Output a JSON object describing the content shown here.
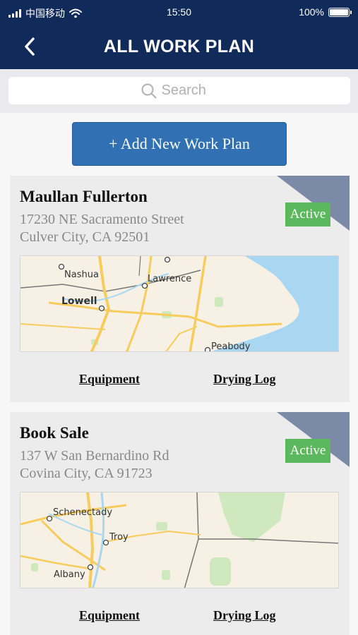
{
  "status_bar": {
    "carrier": "中国移动",
    "time": "15:50",
    "battery": "100%",
    "battery_level": 1.0,
    "signal_icon": "signal-bars-icon",
    "wifi_icon": "wifi-icon"
  },
  "nav": {
    "title": "ALL WORK PLAN",
    "back_icon": "chevron-left-icon"
  },
  "search": {
    "placeholder": "Search",
    "icon": "search-icon"
  },
  "add_button": {
    "label": "+ Add New Work Plan"
  },
  "work_plans": [
    {
      "name": "Maullan Fullerton",
      "address_line1": "17230 NE Sacramento Street",
      "address_line2": "Culver City, CA 92501",
      "status": "Active",
      "map_labels": [
        "Nashua",
        "Lawrence",
        "Lowell",
        "Peabody"
      ],
      "equipment_label": "Equipment",
      "drying_log_label": "Drying Log"
    },
    {
      "name": "Book Sale",
      "address_line1": "137 W San Bernardino Rd",
      "address_line2": "Covina City, CA 91723",
      "status": "Active",
      "map_labels": [
        "Schenectady",
        "Troy",
        "Albany"
      ],
      "equipment_label": "Equipment",
      "drying_log_label": "Drying Log"
    }
  ],
  "colors": {
    "header": "#102a5a",
    "accent_button": "#3070b3",
    "active_badge": "#5cb85c",
    "ribbon": "#7b8ba7",
    "card_bg": "#ececec",
    "map_land": "#f6f1e4",
    "map_water": "#a9d7f2",
    "map_park": "#cfe8bd",
    "map_road": "#f7cc5e"
  }
}
